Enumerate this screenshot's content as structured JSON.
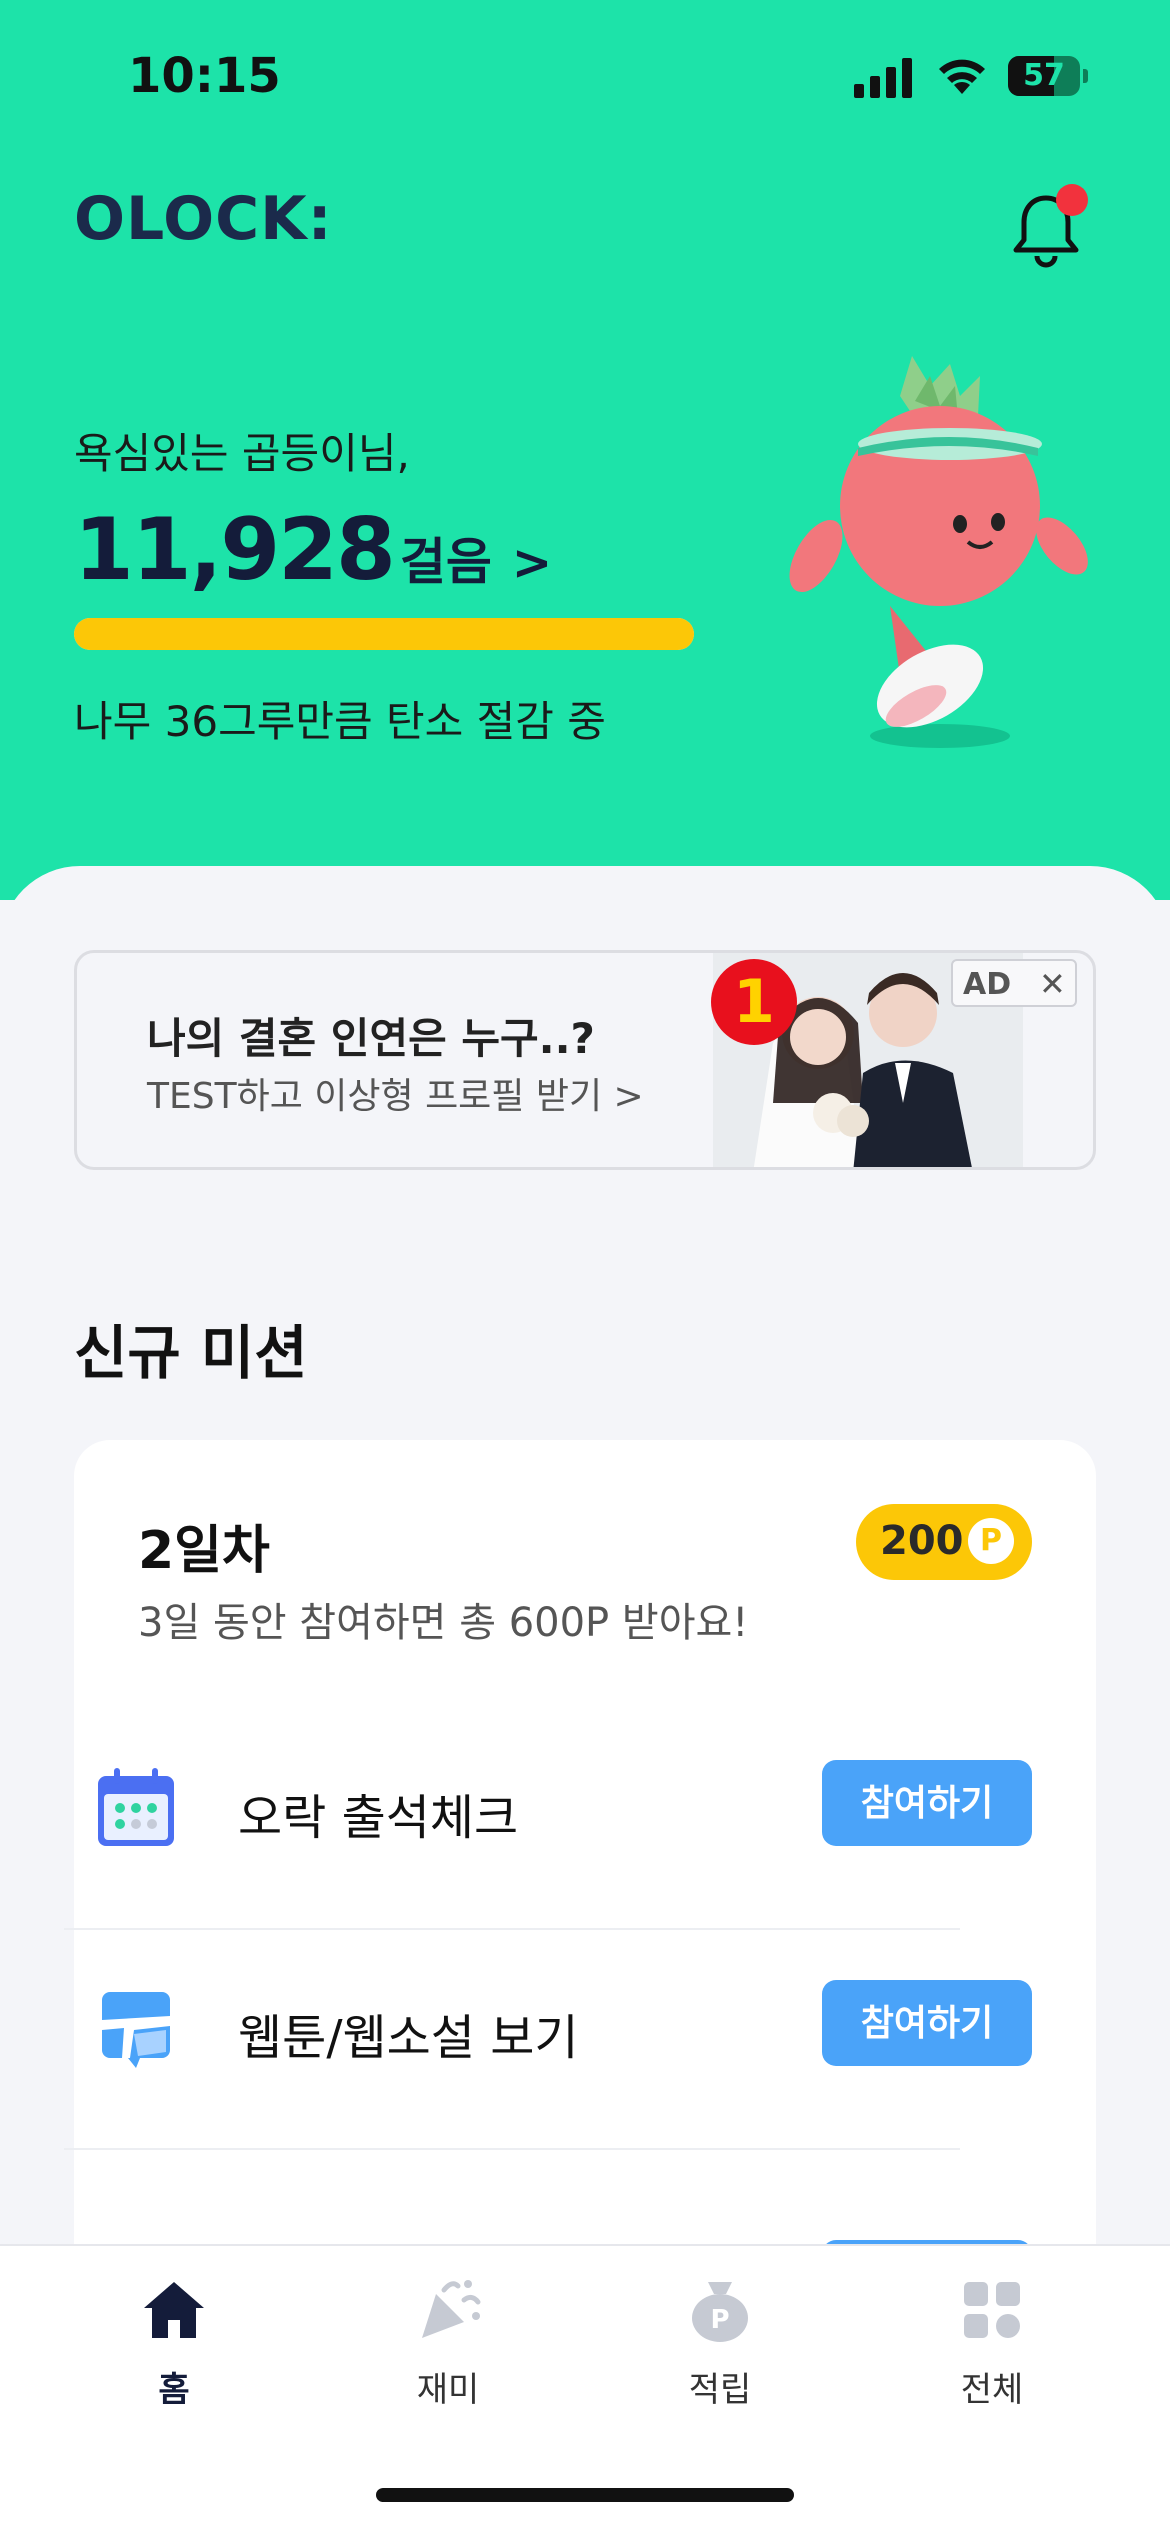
{
  "status": {
    "time": "10:15",
    "battery": "57"
  },
  "header": {
    "logo": "OLOCK:"
  },
  "steps": {
    "greeting": "욕심있는 곱등이님,",
    "count": "11,928",
    "unit": "걸음",
    "chevron": ">",
    "progress": 1.0,
    "carbon_text": "나무 36그루만큼 탄소 절감 중"
  },
  "ad": {
    "title": "나의 결혼 인연은 누구..?",
    "subtitle": "TEST하고 이상형 프로필 받기 >",
    "rank": "1",
    "tag": "AD",
    "close": "✕"
  },
  "missions_section": {
    "title": "신규 미션",
    "day": "2일차",
    "points": "200",
    "points_symbol": "P",
    "description": "3일 동안 참여하면 총 600P 받아요!",
    "items": [
      {
        "label": "오락 출석체크",
        "button": "참여하기",
        "icon": "calendar-icon"
      },
      {
        "label": "웹툰/웹소설 보기",
        "button": "참여하기",
        "icon": "webtoon-icon"
      }
    ]
  },
  "tabs": [
    {
      "label": "홈",
      "icon": "home-icon",
      "active": true
    },
    {
      "label": "재미",
      "icon": "party-popper-icon",
      "active": false
    },
    {
      "label": "적립",
      "icon": "money-bag-icon",
      "active": false
    },
    {
      "label": "전체",
      "icon": "grid-icon",
      "active": false
    }
  ],
  "colors": {
    "brand_green": "#1de3a9",
    "accent_yellow": "#fcc707",
    "button_blue": "#4aa3f9",
    "navy": "#141c3a"
  }
}
